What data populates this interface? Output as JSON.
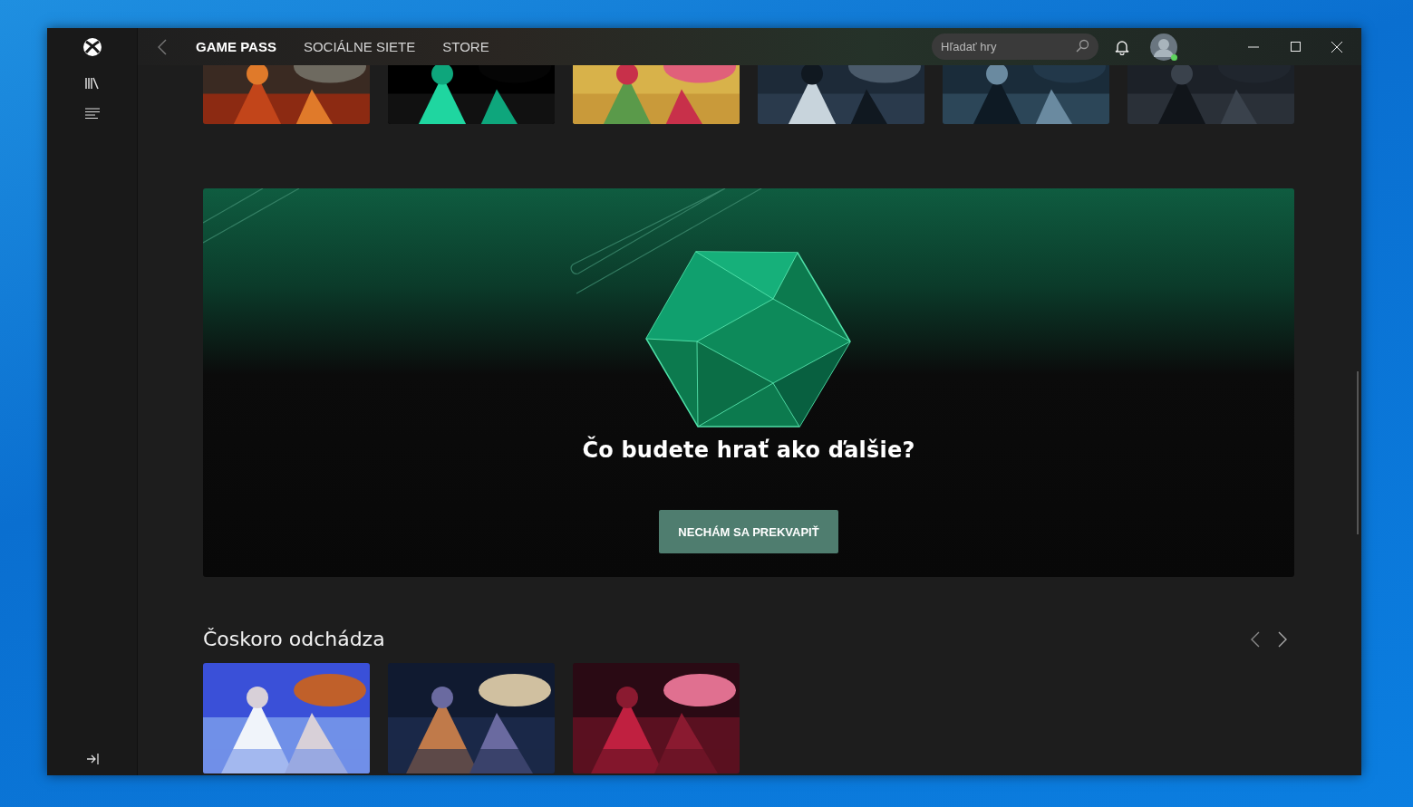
{
  "nav": {
    "tabs": [
      {
        "label": "GAME PASS",
        "selected": true
      },
      {
        "label": "SOCIÁLNE SIETE",
        "selected": false
      },
      {
        "label": "STORE",
        "selected": false
      }
    ]
  },
  "search": {
    "placeholder": "Hľadať hry"
  },
  "profile": {
    "online": true
  },
  "banner": {
    "title": "Čo budete hrať ako ďalšie?",
    "button": "NECHÁM SA PREKVAPIŤ"
  },
  "section": {
    "title": "Čoskoro odchádza"
  }
}
